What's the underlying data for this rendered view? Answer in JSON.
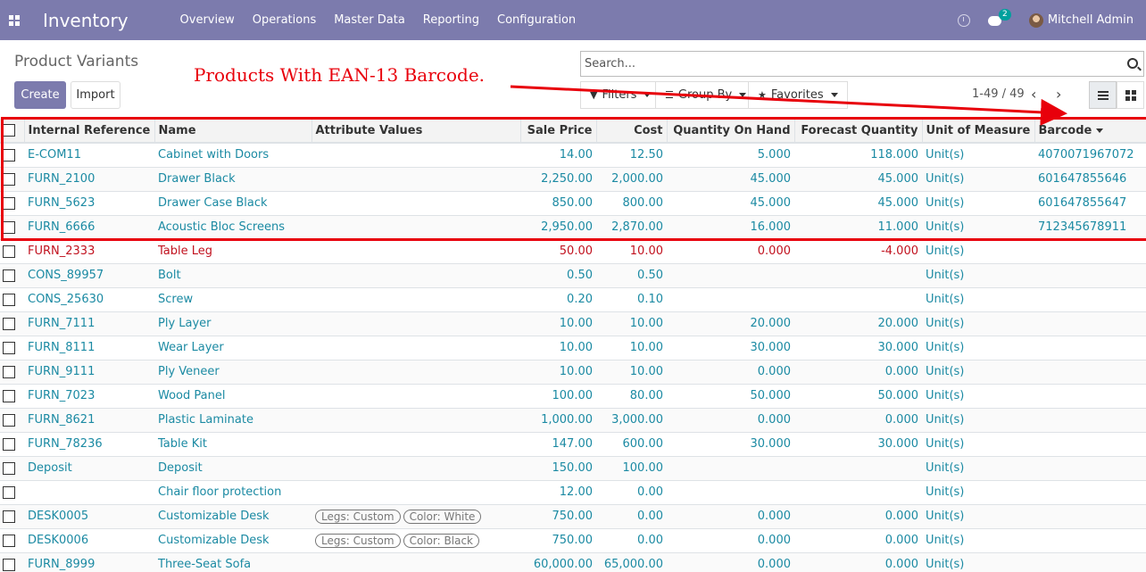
{
  "navbar": {
    "app_name": "Inventory",
    "menu": [
      "Overview",
      "Operations",
      "Master Data",
      "Reporting",
      "Configuration"
    ],
    "chat_badge": "2",
    "user_name": "Mitchell Admin"
  },
  "control_panel": {
    "title": "Product Variants",
    "create_label": "Create",
    "import_label": "Import",
    "search_placeholder": "Search...",
    "filters_label": "Filters",
    "group_by_label": "Group By",
    "favorites_label": "Favorites",
    "pager": "1-49 / 49"
  },
  "annotation": {
    "text": "Products With EAN-13 Barcode.",
    "color": "#e8000b"
  },
  "colors": {
    "navbar": "#7c7bad",
    "link": "#1b8aa3",
    "danger": "#c1121f"
  },
  "table": {
    "columns": [
      "Internal Reference",
      "Name",
      "Attribute Values",
      "Sale Price",
      "Cost",
      "Quantity On Hand",
      "Forecast Quantity",
      "Unit of Measure",
      "Barcode"
    ],
    "rows": [
      {
        "ref": "E-COM11",
        "name": "Cabinet with Doors",
        "attrs": [],
        "sale": "14.00",
        "cost": "12.50",
        "qoh": "5.000",
        "forecast": "118.000",
        "uom": "Unit(s)",
        "barcode": "4070071967072",
        "danger": false
      },
      {
        "ref": "FURN_2100",
        "name": "Drawer Black",
        "attrs": [],
        "sale": "2,250.00",
        "cost": "2,000.00",
        "qoh": "45.000",
        "forecast": "45.000",
        "uom": "Unit(s)",
        "barcode": "601647855646",
        "danger": false
      },
      {
        "ref": "FURN_5623",
        "name": "Drawer Case Black",
        "attrs": [],
        "sale": "850.00",
        "cost": "800.00",
        "qoh": "45.000",
        "forecast": "45.000",
        "uom": "Unit(s)",
        "barcode": "601647855647",
        "danger": false
      },
      {
        "ref": "FURN_6666",
        "name": "Acoustic Bloc Screens",
        "attrs": [],
        "sale": "2,950.00",
        "cost": "2,870.00",
        "qoh": "16.000",
        "forecast": "11.000",
        "uom": "Unit(s)",
        "barcode": "712345678911",
        "danger": false
      },
      {
        "ref": "FURN_2333",
        "name": "Table Leg",
        "attrs": [],
        "sale": "50.00",
        "cost": "10.00",
        "qoh": "0.000",
        "forecast": "-4.000",
        "uom": "Unit(s)",
        "barcode": "",
        "danger": true
      },
      {
        "ref": "CONS_89957",
        "name": "Bolt",
        "attrs": [],
        "sale": "0.50",
        "cost": "0.50",
        "qoh": "",
        "forecast": "",
        "uom": "Unit(s)",
        "barcode": "",
        "danger": false
      },
      {
        "ref": "CONS_25630",
        "name": "Screw",
        "attrs": [],
        "sale": "0.20",
        "cost": "0.10",
        "qoh": "",
        "forecast": "",
        "uom": "Unit(s)",
        "barcode": "",
        "danger": false
      },
      {
        "ref": "FURN_7111",
        "name": "Ply Layer",
        "attrs": [],
        "sale": "10.00",
        "cost": "10.00",
        "qoh": "20.000",
        "forecast": "20.000",
        "uom": "Unit(s)",
        "barcode": "",
        "danger": false
      },
      {
        "ref": "FURN_8111",
        "name": "Wear Layer",
        "attrs": [],
        "sale": "10.00",
        "cost": "10.00",
        "qoh": "30.000",
        "forecast": "30.000",
        "uom": "Unit(s)",
        "barcode": "",
        "danger": false
      },
      {
        "ref": "FURN_9111",
        "name": "Ply Veneer",
        "attrs": [],
        "sale": "10.00",
        "cost": "10.00",
        "qoh": "0.000",
        "forecast": "0.000",
        "uom": "Unit(s)",
        "barcode": "",
        "danger": false
      },
      {
        "ref": "FURN_7023",
        "name": "Wood Panel",
        "attrs": [],
        "sale": "100.00",
        "cost": "80.00",
        "qoh": "50.000",
        "forecast": "50.000",
        "uom": "Unit(s)",
        "barcode": "",
        "danger": false
      },
      {
        "ref": "FURN_8621",
        "name": "Plastic Laminate",
        "attrs": [],
        "sale": "1,000.00",
        "cost": "3,000.00",
        "qoh": "0.000",
        "forecast": "0.000",
        "uom": "Unit(s)",
        "barcode": "",
        "danger": false
      },
      {
        "ref": "FURN_78236",
        "name": "Table Kit",
        "attrs": [],
        "sale": "147.00",
        "cost": "600.00",
        "qoh": "30.000",
        "forecast": "30.000",
        "uom": "Unit(s)",
        "barcode": "",
        "danger": false
      },
      {
        "ref": "Deposit",
        "name": "Deposit",
        "attrs": [],
        "sale": "150.00",
        "cost": "100.00",
        "qoh": "",
        "forecast": "",
        "uom": "Unit(s)",
        "barcode": "",
        "danger": false
      },
      {
        "ref": "",
        "name": "Chair floor protection",
        "attrs": [],
        "sale": "12.00",
        "cost": "0.00",
        "qoh": "",
        "forecast": "",
        "uom": "Unit(s)",
        "barcode": "",
        "danger": false
      },
      {
        "ref": "DESK0005",
        "name": "Customizable Desk",
        "attrs": [
          "Legs: Custom",
          "Color: White"
        ],
        "sale": "750.00",
        "cost": "0.00",
        "qoh": "0.000",
        "forecast": "0.000",
        "uom": "Unit(s)",
        "barcode": "",
        "danger": false
      },
      {
        "ref": "DESK0006",
        "name": "Customizable Desk",
        "attrs": [
          "Legs: Custom",
          "Color: Black"
        ],
        "sale": "750.00",
        "cost": "0.00",
        "qoh": "0.000",
        "forecast": "0.000",
        "uom": "Unit(s)",
        "barcode": "",
        "danger": false
      },
      {
        "ref": "FURN_8999",
        "name": "Three-Seat Sofa",
        "attrs": [],
        "sale": "60,000.00",
        "cost": "65,000.00",
        "qoh": "0.000",
        "forecast": "0.000",
        "uom": "Unit(s)",
        "barcode": "",
        "danger": false
      }
    ]
  }
}
